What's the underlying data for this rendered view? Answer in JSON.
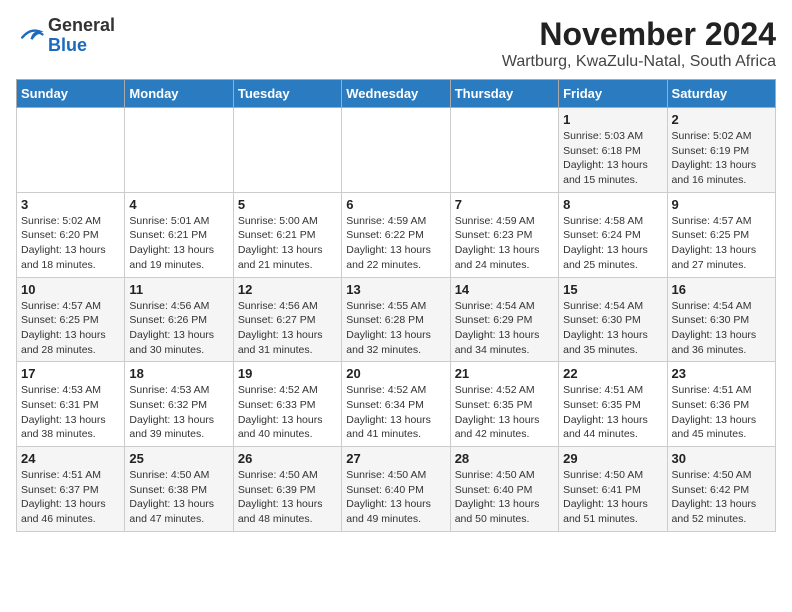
{
  "header": {
    "logo_general": "General",
    "logo_blue": "Blue",
    "month_title": "November 2024",
    "subtitle": "Wartburg, KwaZulu-Natal, South Africa"
  },
  "days_of_week": [
    "Sunday",
    "Monday",
    "Tuesday",
    "Wednesday",
    "Thursday",
    "Friday",
    "Saturday"
  ],
  "weeks": [
    [
      {
        "day": "",
        "info": ""
      },
      {
        "day": "",
        "info": ""
      },
      {
        "day": "",
        "info": ""
      },
      {
        "day": "",
        "info": ""
      },
      {
        "day": "",
        "info": ""
      },
      {
        "day": "1",
        "info": "Sunrise: 5:03 AM\nSunset: 6:18 PM\nDaylight: 13 hours and 15 minutes."
      },
      {
        "day": "2",
        "info": "Sunrise: 5:02 AM\nSunset: 6:19 PM\nDaylight: 13 hours and 16 minutes."
      }
    ],
    [
      {
        "day": "3",
        "info": "Sunrise: 5:02 AM\nSunset: 6:20 PM\nDaylight: 13 hours and 18 minutes."
      },
      {
        "day": "4",
        "info": "Sunrise: 5:01 AM\nSunset: 6:21 PM\nDaylight: 13 hours and 19 minutes."
      },
      {
        "day": "5",
        "info": "Sunrise: 5:00 AM\nSunset: 6:21 PM\nDaylight: 13 hours and 21 minutes."
      },
      {
        "day": "6",
        "info": "Sunrise: 4:59 AM\nSunset: 6:22 PM\nDaylight: 13 hours and 22 minutes."
      },
      {
        "day": "7",
        "info": "Sunrise: 4:59 AM\nSunset: 6:23 PM\nDaylight: 13 hours and 24 minutes."
      },
      {
        "day": "8",
        "info": "Sunrise: 4:58 AM\nSunset: 6:24 PM\nDaylight: 13 hours and 25 minutes."
      },
      {
        "day": "9",
        "info": "Sunrise: 4:57 AM\nSunset: 6:25 PM\nDaylight: 13 hours and 27 minutes."
      }
    ],
    [
      {
        "day": "10",
        "info": "Sunrise: 4:57 AM\nSunset: 6:25 PM\nDaylight: 13 hours and 28 minutes."
      },
      {
        "day": "11",
        "info": "Sunrise: 4:56 AM\nSunset: 6:26 PM\nDaylight: 13 hours and 30 minutes."
      },
      {
        "day": "12",
        "info": "Sunrise: 4:56 AM\nSunset: 6:27 PM\nDaylight: 13 hours and 31 minutes."
      },
      {
        "day": "13",
        "info": "Sunrise: 4:55 AM\nSunset: 6:28 PM\nDaylight: 13 hours and 32 minutes."
      },
      {
        "day": "14",
        "info": "Sunrise: 4:54 AM\nSunset: 6:29 PM\nDaylight: 13 hours and 34 minutes."
      },
      {
        "day": "15",
        "info": "Sunrise: 4:54 AM\nSunset: 6:30 PM\nDaylight: 13 hours and 35 minutes."
      },
      {
        "day": "16",
        "info": "Sunrise: 4:54 AM\nSunset: 6:30 PM\nDaylight: 13 hours and 36 minutes."
      }
    ],
    [
      {
        "day": "17",
        "info": "Sunrise: 4:53 AM\nSunset: 6:31 PM\nDaylight: 13 hours and 38 minutes."
      },
      {
        "day": "18",
        "info": "Sunrise: 4:53 AM\nSunset: 6:32 PM\nDaylight: 13 hours and 39 minutes."
      },
      {
        "day": "19",
        "info": "Sunrise: 4:52 AM\nSunset: 6:33 PM\nDaylight: 13 hours and 40 minutes."
      },
      {
        "day": "20",
        "info": "Sunrise: 4:52 AM\nSunset: 6:34 PM\nDaylight: 13 hours and 41 minutes."
      },
      {
        "day": "21",
        "info": "Sunrise: 4:52 AM\nSunset: 6:35 PM\nDaylight: 13 hours and 42 minutes."
      },
      {
        "day": "22",
        "info": "Sunrise: 4:51 AM\nSunset: 6:35 PM\nDaylight: 13 hours and 44 minutes."
      },
      {
        "day": "23",
        "info": "Sunrise: 4:51 AM\nSunset: 6:36 PM\nDaylight: 13 hours and 45 minutes."
      }
    ],
    [
      {
        "day": "24",
        "info": "Sunrise: 4:51 AM\nSunset: 6:37 PM\nDaylight: 13 hours and 46 minutes."
      },
      {
        "day": "25",
        "info": "Sunrise: 4:50 AM\nSunset: 6:38 PM\nDaylight: 13 hours and 47 minutes."
      },
      {
        "day": "26",
        "info": "Sunrise: 4:50 AM\nSunset: 6:39 PM\nDaylight: 13 hours and 48 minutes."
      },
      {
        "day": "27",
        "info": "Sunrise: 4:50 AM\nSunset: 6:40 PM\nDaylight: 13 hours and 49 minutes."
      },
      {
        "day": "28",
        "info": "Sunrise: 4:50 AM\nSunset: 6:40 PM\nDaylight: 13 hours and 50 minutes."
      },
      {
        "day": "29",
        "info": "Sunrise: 4:50 AM\nSunset: 6:41 PM\nDaylight: 13 hours and 51 minutes."
      },
      {
        "day": "30",
        "info": "Sunrise: 4:50 AM\nSunset: 6:42 PM\nDaylight: 13 hours and 52 minutes."
      }
    ]
  ]
}
